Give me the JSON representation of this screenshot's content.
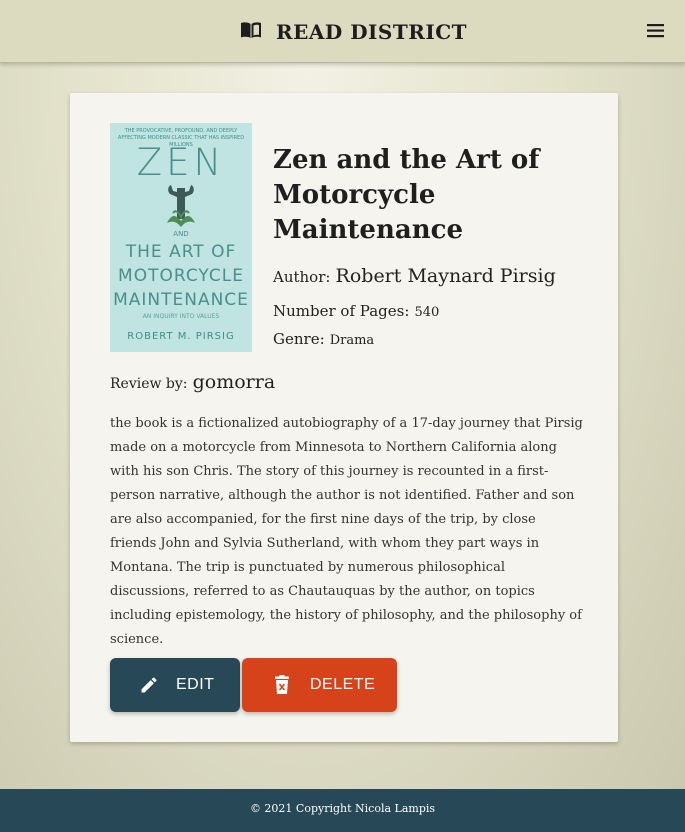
{
  "header": {
    "brand": "READ DISTRICT",
    "brand_icon": "open-book-icon",
    "menu_icon": "hamburger-menu-icon"
  },
  "book": {
    "cover": {
      "tagline": "The provocative, profound, and deeply affecting modern classic that has inspired millions",
      "zen": "ZEN",
      "and": "AND",
      "rest": "THE ART OF\nMOTORCYCLE\nMAINTENANCE",
      "subtitle": "AN INQUIRY INTO VALUES",
      "author": "ROBERT M. PIRSIG"
    },
    "title": "Zen and the Art of Motorcycle Maintenance",
    "author_label": "Author:",
    "author": "Robert Maynard Pirsig",
    "pages_label": "Number of Pages:",
    "pages": "540",
    "genre_label": "Genre:",
    "genre": "Drama",
    "review_by_label": "Review by:",
    "reviewer": "gomorra",
    "review": "the book is a fictionalized autobiography of a 17-day journey that Pirsig made on a motorcycle from Minnesota to Northern California along with his son Chris. The story of this journey is recounted in a first-person narrative, although the author is not identified. Father and son are also accompanied, for the first nine days of the trip, by close friends John and Sylvia Sutherland, with whom they part ways in Montana. The trip is punctuated by numerous philosophical discussions, referred to as Chautauquas by the author, on topics including epistemology, the history of philosophy, and the philosophy of science."
  },
  "actions": {
    "edit_label": "EDIT",
    "edit_icon": "pencil-icon",
    "delete_label": "DELETE",
    "delete_icon": "trash-icon"
  },
  "footer": {
    "text": "© 2021 Copyright Nicola Lampis"
  },
  "colors": {
    "navbar": "#dcdbc0",
    "primary": "#274857",
    "danger": "#d6421a",
    "card": "#f5f4ee"
  }
}
